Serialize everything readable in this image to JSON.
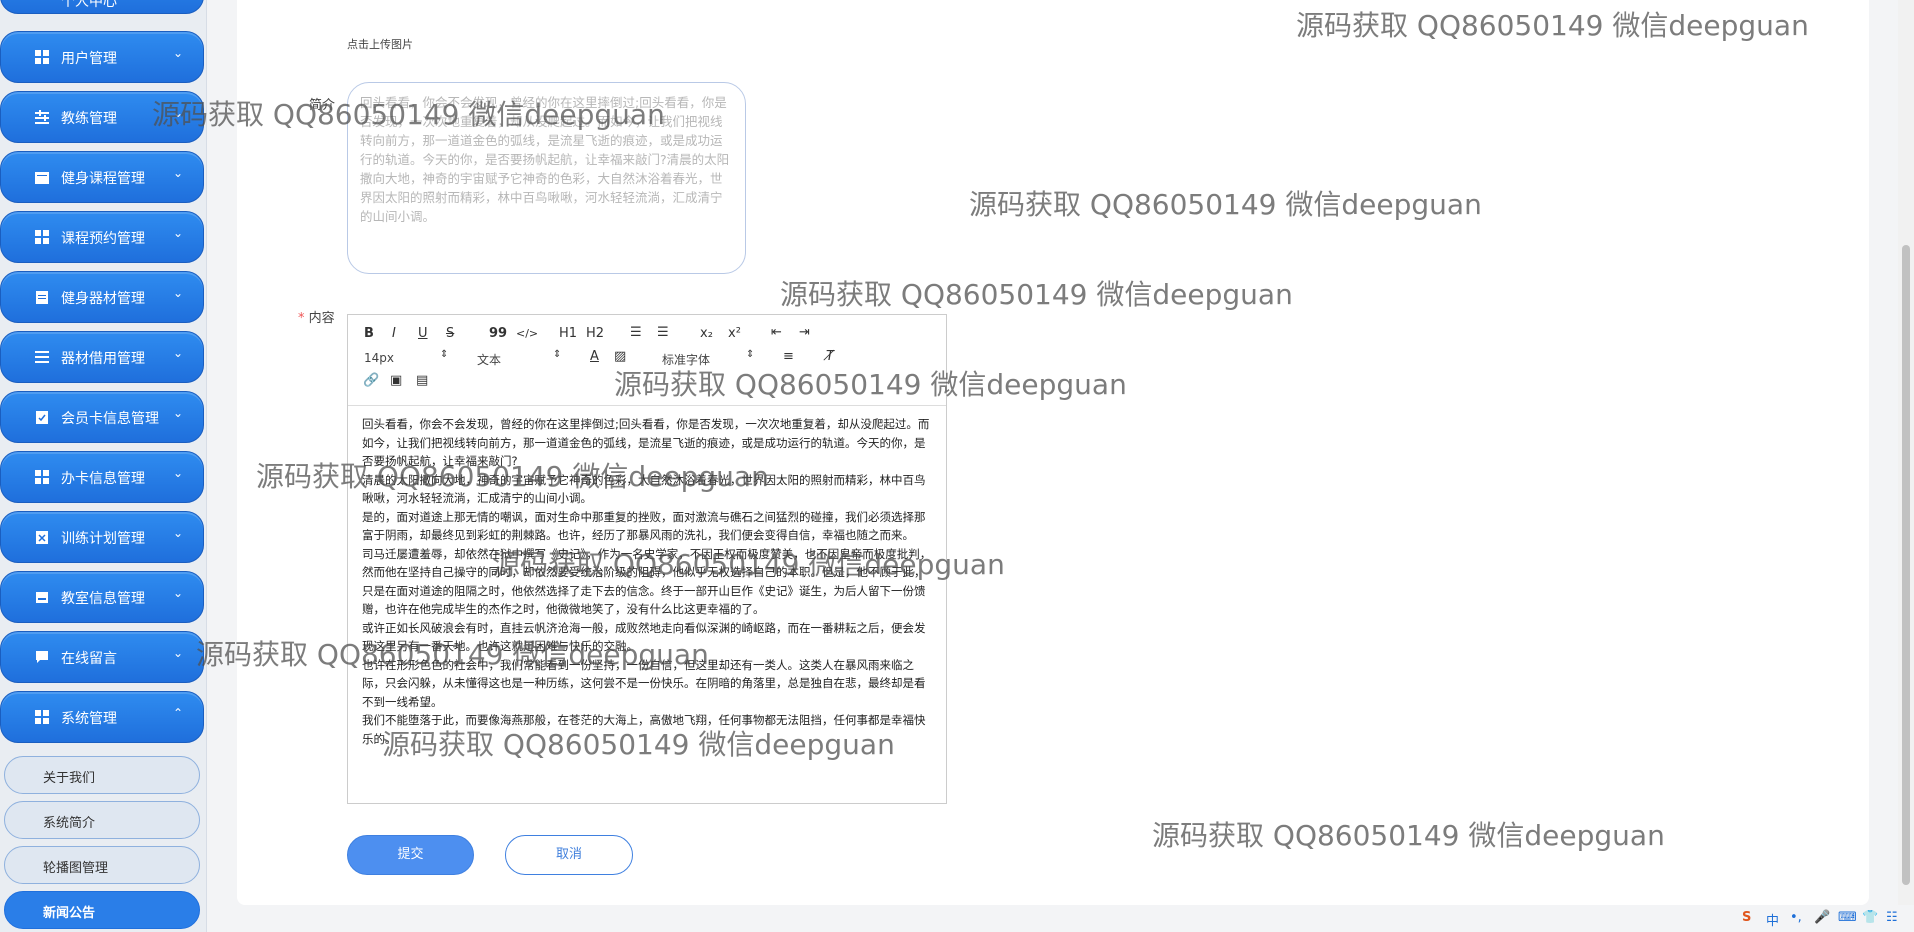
{
  "sidebar": {
    "top_partial": "个人中心",
    "items": [
      {
        "label": "用户管理",
        "icon": "grid-icon",
        "chevron": "⌄"
      },
      {
        "label": "教练管理",
        "icon": "sliders-icon",
        "chevron": "⌄"
      },
      {
        "label": "健身课程管理",
        "icon": "calendar-icon",
        "chevron": "⌄"
      },
      {
        "label": "课程预约管理",
        "icon": "grid-icon",
        "chevron": "⌄"
      },
      {
        "label": "健身器材管理",
        "icon": "clipboard-icon",
        "chevron": "⌄"
      },
      {
        "label": "器材借用管理",
        "icon": "list-icon",
        "chevron": "⌄"
      },
      {
        "label": "会员卡信息管理",
        "icon": "clipboard-check-icon",
        "chevron": "⌄"
      },
      {
        "label": "办卡信息管理",
        "icon": "grid-icon",
        "chevron": "⌄"
      },
      {
        "label": "训练计划管理",
        "icon": "clipboard-x-icon",
        "chevron": "⌄"
      },
      {
        "label": "教室信息管理",
        "icon": "inbox-icon",
        "chevron": "⌄"
      },
      {
        "label": "在线留言",
        "icon": "chat-icon",
        "chevron": "⌄"
      },
      {
        "label": "系统管理",
        "icon": "grid-icon",
        "chevron": "⌃"
      }
    ],
    "sub_items": [
      "关于我们",
      "系统简介",
      "轮播图管理",
      "新闻公告"
    ]
  },
  "form": {
    "upload_hint": "点击上传图片",
    "intro_label": "简介",
    "intro_text": "回头看看，你会不会发现，曾经的你在这里摔倒过;回头看看，你是否发现，一次次地重复着，却从没爬起过。而如今，让我们把视线转向前方，那一道道金色的弧线，是流星飞逝的痕迹，或是成功运行的轨道。今天的你，是否要扬帆起航，让幸福来敲门?清晨的太阳撒向大地，神奇的宇宙赋予它神奇的色彩，大自然沐浴着春光，世界因太阳的照射而精彩，林中百鸟啾啾，河水轻轻流淌，汇成清宁的山间小调。",
    "content_label": "内容",
    "required_mark": "*",
    "toolbar": {
      "size": "14px",
      "type": "文本",
      "font": "标准字体",
      "bold": "B",
      "italic": "I",
      "underline": "U",
      "strike": "S",
      "quote": "99",
      "code": "</>",
      "h1": "H1",
      "h2": "H2",
      "sub": "x₂",
      "sup": "x²"
    },
    "content_paragraphs": [
      "回头看看，你会不会发现，曾经的你在这里摔倒过;回头看看，你是否发现，一次次地重复着，却从没爬起过。而如今，让我们把视线转向前方，那一道道金色的弧线，是流星飞逝的痕迹，或是成功运行的轨道。今天的你，是否要扬帆起航，让幸福来敲门?",
      "清晨的太阳撒向大地，神奇的宇宙赋予它神奇的色彩，大自然沐浴着春光，世界因太阳的照射而精彩，林中百鸟啾啾，河水轻轻流淌，汇成清宁的山间小调。",
      "是的，面对道途上那无情的嘲讽，面对生命中那重复的挫败，面对激流与礁石之间猛烈的碰撞，我们必须选择那富于阴雨，却最终见到彩虹的荆棘路。也许，经历了那暴风雨的洗礼，我们便会变得自信，幸福也随之而来。",
      "司马迁屡遭羞辱，却依然在狱中撰写《史记》，作为一名史学家，不因王权而极度赞美，也不因皇帝而极度批判，然而他在坚持自己操守的同时，却依然要受统治阶级的阻碍，他似乎无权选择自己的本职。但是，他不顾于此，只是在面对道途的阻隔之时，他依然选择了走下去的信念。终于一部开山巨作《史记》诞生，为后人留下一份馈赠，也许在他完成毕生的杰作之时，他微微地笑了，没有什么比这更幸福的了。",
      "或许正如长风破浪会有时，直挂云帆济沧海一般，成败然地走向看似深渊的崎岖路，而在一番耕耘之后，便会发现这里另有一番天地。也许这就是困难与快乐的交融。",
      "也许在形形色色的社会中，我们常能看到一份坚持，一份自信，但这里却还有一类人。这类人在暴风雨来临之际，只会闪躲，从未懂得这也是一种历练，这何尝不是一份快乐。在阴暗的角落里，总是独自在悲，最终却是看不到一线希望。",
      "我们不能堕落于此，而要像海燕那般，在苍茫的大海上，高傲地飞翔，任何事物都无法阻挡，任何事都是幸福快乐的。"
    ],
    "submit_label": "提交",
    "cancel_label": "取消"
  },
  "watermark_text": "源码获取 QQ86050149 微信deepguan",
  "taskbar": [
    "S",
    "中",
    "•,",
    "🎤",
    "⌨",
    "👕",
    "☷"
  ]
}
